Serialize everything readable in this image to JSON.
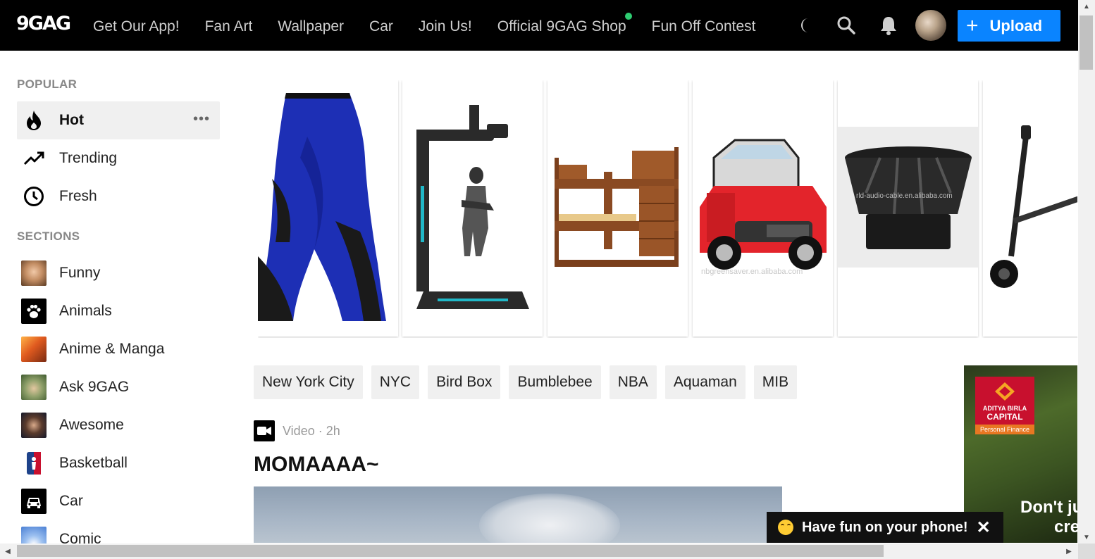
{
  "header": {
    "logo": "9GAG",
    "nav": [
      "Get Our App!",
      "Fan Art",
      "Wallpaper",
      "Car",
      "Join Us!",
      "Official 9GAG Shop",
      "Fun Off Contest"
    ],
    "icons": [
      "moon-icon",
      "search-icon",
      "bell-icon"
    ],
    "upload_plus": "+",
    "upload_label": "Upload"
  },
  "sidebar": {
    "popular_heading": "POPULAR",
    "popular": [
      {
        "label": "Hot",
        "icon": "flame-icon"
      },
      {
        "label": "Trending",
        "icon": "trending-icon"
      },
      {
        "label": "Fresh",
        "icon": "clock-icon"
      }
    ],
    "more_label": "•••",
    "sections_heading": "SECTIONS",
    "sections": [
      {
        "label": "Funny",
        "color": "#8a5a3c"
      },
      {
        "label": "Animals",
        "color": "#000000"
      },
      {
        "label": "Anime & Manga",
        "color": "#e07a1f"
      },
      {
        "label": "Ask 9GAG",
        "color": "#5f7f45"
      },
      {
        "label": "Awesome",
        "color": "#1c2a4a"
      },
      {
        "label": "Basketball",
        "color": "#1d428a"
      },
      {
        "label": "Car",
        "color": "#000000"
      },
      {
        "label": "Comic",
        "color": "#4a7fd4"
      }
    ]
  },
  "carousel": {
    "items": [
      "leggings",
      "vr-simulator",
      "bunk-bed",
      "electric-car",
      "subwoofer",
      "scooter"
    ],
    "watermark_1": "nbgreensaver.en.alibaba.com",
    "watermark_2": "rld-audio-cable.en.alibaba.com"
  },
  "tags": [
    "New York City",
    "NYC",
    "Bird Box",
    "Bumblebee",
    "NBA",
    "Aquaman",
    "MIB"
  ],
  "post": {
    "meta": "Video · 2h",
    "title": "MOMAAAA~"
  },
  "ad": {
    "brand_line1": "ADITYA BIRLA",
    "brand_line2": "CAPITAL",
    "brand_line3": "Personal Finance",
    "text_line1": "Don't ju",
    "text_line2": "cre"
  },
  "toast": {
    "label": "Have fun on your phone!",
    "close": "✕"
  },
  "colors": {
    "accent": "#0a84ff",
    "topbar": "#000000",
    "shop_dot": "#2ecc71"
  }
}
